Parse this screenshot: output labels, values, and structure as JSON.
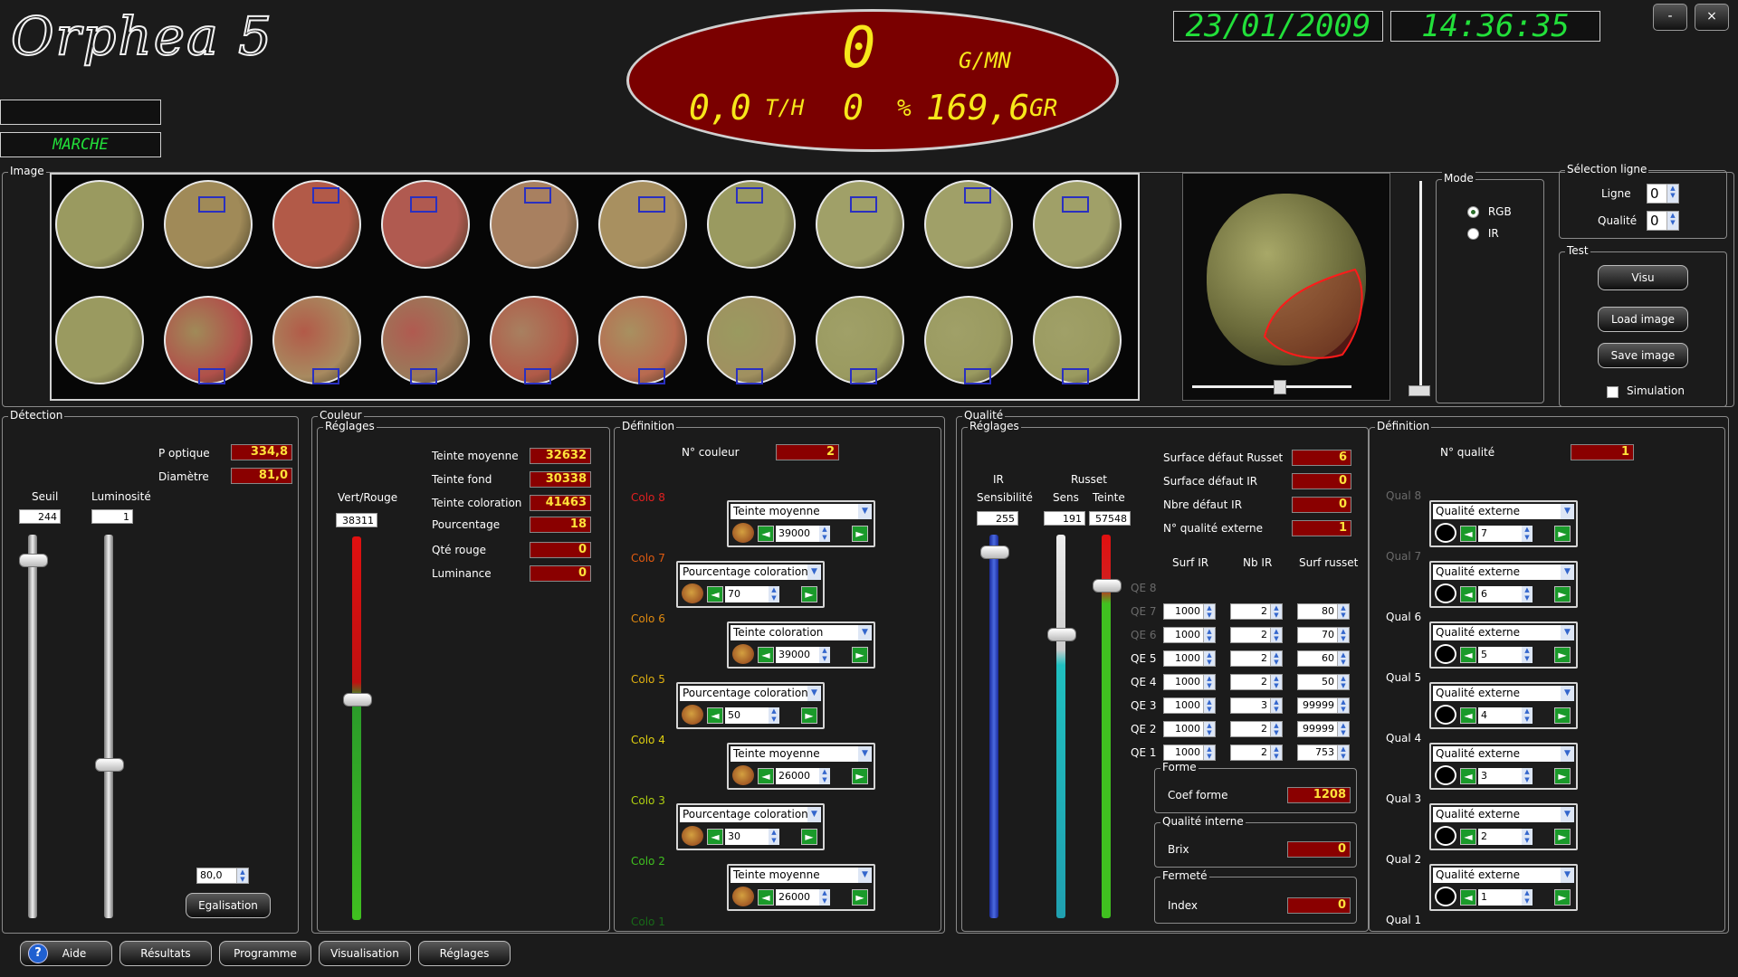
{
  "app": {
    "title": "Orphea 5",
    "date": "23/01/2009",
    "time": "14:36:35",
    "min_label": "-",
    "close_label": "×"
  },
  "status": {
    "blank": "",
    "state": "MARCHE"
  },
  "ellipse": {
    "main_value": "0",
    "main_unit": "G/MN",
    "th_value": "0,0",
    "th_unit": "T/H",
    "pct_value": "0",
    "pct_unit": "%",
    "gr_value": "169,6",
    "gr_unit": "GR"
  },
  "image_panel": {
    "title": "Image"
  },
  "mode": {
    "title": "Mode",
    "options": [
      "RGB",
      "IR"
    ],
    "selected": "RGB"
  },
  "selection": {
    "title": "Sélection ligne",
    "ligne_label": "Ligne",
    "ligne_value": "0",
    "qualite_label": "Qualité",
    "qualite_value": "0"
  },
  "test": {
    "title": "Test",
    "visu": "Visu",
    "load": "Load image",
    "save": "Save image",
    "simulation": "Simulation"
  },
  "detection": {
    "title": "Détection",
    "p_optique_label": "P optique",
    "p_optique": "334,8",
    "diametre_label": "Diamètre",
    "diametre": "81,0",
    "seuil_label": "Seuil",
    "seuil": "244",
    "lum_label": "Luminosité",
    "lum": "1",
    "egal_value": "80,0",
    "egal_button": "Egalisation",
    "seuil_level": 0.95,
    "lum_level": 0.4
  },
  "couleur": {
    "title": "Couleur",
    "reglages_title": "Réglages",
    "vr_label": "Vert/Rouge",
    "vr_value": "38311",
    "vr_level": 0.58,
    "stats": [
      {
        "label": "Teinte moyenne",
        "value": "32632"
      },
      {
        "label": "Teinte fond",
        "value": "30338"
      },
      {
        "label": "Teinte coloration",
        "value": "41463"
      },
      {
        "label": "Pourcentage",
        "value": "18"
      },
      {
        "label": "Qté rouge",
        "value": "0"
      },
      {
        "label": "Luminance",
        "value": "0"
      }
    ],
    "definition_title": "Définition",
    "n_couleur_label": "N° couleur",
    "n_couleur": "2",
    "colos": [
      {
        "label": "Colo 8",
        "color": "#e02020"
      },
      {
        "label": "Colo 7",
        "color": "#e05a10"
      },
      {
        "label": "Colo 6",
        "color": "#e08a10"
      },
      {
        "label": "Colo 5",
        "color": "#e0b010"
      },
      {
        "label": "Colo 4",
        "color": "#e0d010"
      },
      {
        "label": "Colo 3",
        "color": "#b0d010"
      },
      {
        "label": "Colo 2",
        "color": "#40c020"
      },
      {
        "label": "Colo 1",
        "color": "#186a18"
      }
    ],
    "dropdowns": [
      {
        "sel": "Teinte moyenne",
        "num": "39000"
      },
      {
        "sel": "Pourcentage coloration",
        "num": "70"
      },
      {
        "sel": "Teinte coloration",
        "num": "39000"
      },
      {
        "sel": "Pourcentage coloration",
        "num": "50"
      },
      {
        "sel": "Teinte moyenne",
        "num": "26000"
      },
      {
        "sel": "Pourcentage coloration",
        "num": "30"
      },
      {
        "sel": "Teinte moyenne",
        "num": "26000"
      }
    ]
  },
  "qualite": {
    "title": "Qualité",
    "reglages_title": "Réglages",
    "ir_label": "IR",
    "sens_label": "Sensibilité",
    "ir_sens": "255",
    "russet_label": "Russet",
    "russet_sens_label": "Sens",
    "russet_teinte_label": "Teinte",
    "russet_sens": "191",
    "russet_teinte": "57548",
    "ir_level": 0.97,
    "russet_sens_level": 0.75,
    "russet_teinte_level": 0.88,
    "stats": [
      {
        "label": "Surface défaut Russet",
        "value": "6"
      },
      {
        "label": "Surface défaut IR",
        "value": "0"
      },
      {
        "label": "Nbre défaut IR",
        "value": "0"
      },
      {
        "label": "N° qualité externe",
        "value": "1"
      }
    ],
    "table_headers": [
      "Surf IR",
      "Nb IR",
      "Surf russet"
    ],
    "qe_rows": [
      {
        "label": "QE 8",
        "surf_ir": "",
        "nb_ir": "",
        "surf_russet": "",
        "dim": true
      },
      {
        "label": "QE 7",
        "surf_ir": "1000",
        "nb_ir": "2",
        "surf_russet": "80",
        "dim": true
      },
      {
        "label": "QE 6",
        "surf_ir": "1000",
        "nb_ir": "2",
        "surf_russet": "70",
        "dim": true
      },
      {
        "label": "QE 5",
        "surf_ir": "1000",
        "nb_ir": "2",
        "surf_russet": "60",
        "dim": false
      },
      {
        "label": "QE 4",
        "surf_ir": "1000",
        "nb_ir": "2",
        "surf_russet": "50",
        "dim": false
      },
      {
        "label": "QE 3",
        "surf_ir": "1000",
        "nb_ir": "3",
        "surf_russet": "99999",
        "dim": false
      },
      {
        "label": "QE 2",
        "surf_ir": "1000",
        "nb_ir": "2",
        "surf_russet": "99999",
        "dim": false
      },
      {
        "label": "QE 1",
        "surf_ir": "1000",
        "nb_ir": "2",
        "surf_russet": "753",
        "dim": false
      }
    ],
    "forme_title": "Forme",
    "coef_label": "Coef forme",
    "coef": "1208",
    "interne_title": "Qualité interne",
    "brix_label": "Brix",
    "brix": "0",
    "fermete_title": "Fermeté",
    "index_label": "Index",
    "index": "0",
    "definition_title": "Définition",
    "n_qualite_label": "N° qualité",
    "n_qualite": "1",
    "quals": [
      "Qual 8",
      "Qual 7",
      "Qual 6",
      "Qual 5",
      "Qual 4",
      "Qual 3",
      "Qual 2",
      "Qual 1"
    ],
    "qual_dropdowns": [
      {
        "sel": "Qualité externe",
        "num": "7"
      },
      {
        "sel": "Qualité externe",
        "num": "6"
      },
      {
        "sel": "Qualité externe",
        "num": "5"
      },
      {
        "sel": "Qualité externe",
        "num": "4"
      },
      {
        "sel": "Qualité externe",
        "num": "3"
      },
      {
        "sel": "Qualité externe",
        "num": "2"
      },
      {
        "sel": "Qualité externe",
        "num": "1"
      }
    ]
  },
  "bottom": {
    "aide": "Aide",
    "resultats": "Résultats",
    "programme": "Programme",
    "visualisation": "Visualisation",
    "reglages": "Réglages"
  },
  "icons": {
    "help": "help-icon",
    "apple": "apple-icon",
    "dial": "dial-icon",
    "prev": "arrow-left-icon",
    "next": "arrow-right-icon"
  }
}
